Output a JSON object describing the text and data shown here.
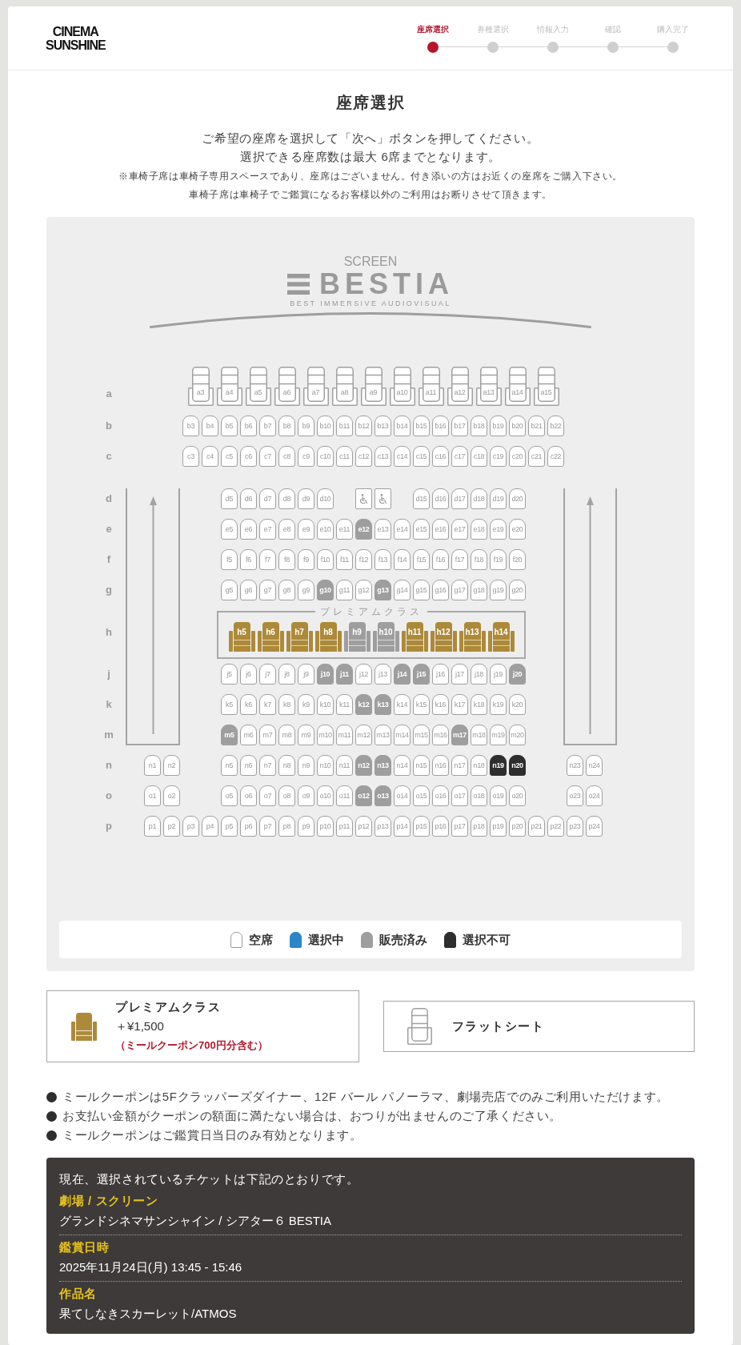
{
  "header": {
    "logo": "CINEMA SUNSHINE",
    "steps": [
      {
        "label": "座席選択",
        "selected": true
      },
      {
        "label": "券種選択",
        "selected": false
      },
      {
        "label": "情報入力",
        "selected": false
      },
      {
        "label": "確認",
        "selected": false
      },
      {
        "label": "購入完了",
        "selected": false
      }
    ]
  },
  "title": "座席選択",
  "instructions": [
    "ご希望の座席を選択して「次へ」ボタンを押してください。",
    "選択できる座席数は最大 6席までとなります。"
  ],
  "notices": [
    "※車椅子席は車椅子専用スペースであり、座席はございません。付き添いの方はお近くの座席をご購入下さい。",
    "車椅子席は車椅子でご鑑賞になるお客様以外のご利用はお断りさせて頂きます。"
  ],
  "seat_map": {
    "screen": {
      "caption": "SCREEN",
      "name": "BESTIA",
      "tagline": "BEST IMMERSIVE AUDIOVISUAL"
    },
    "blocks": [
      {
        "aisles": false,
        "rows": [
          {
            "label": "a",
            "kind": "flat",
            "seats": [
              {
                "kind": "free",
                "label": "a3"
              },
              {
                "kind": "free",
                "label": "a4"
              },
              {
                "kind": "free",
                "label": "a5"
              },
              {
                "kind": "free",
                "label": "a6"
              },
              {
                "kind": "free",
                "label": "a7"
              },
              {
                "kind": "free",
                "label": "a8"
              },
              {
                "kind": "free",
                "label": "a9"
              },
              {
                "kind": "free",
                "label": "a10"
              },
              {
                "kind": "free",
                "label": "a11"
              },
              {
                "kind": "free",
                "label": "a12"
              },
              {
                "kind": "free",
                "label": "a13"
              },
              {
                "kind": "free",
                "label": "a14"
              },
              {
                "kind": "free",
                "label": "a15"
              }
            ]
          },
          {
            "label": "b",
            "kind": "standard",
            "seats": [
              {
                "kind": "free",
                "label": "b3"
              },
              {
                "kind": "free",
                "label": "b4"
              },
              {
                "kind": "free",
                "label": "b5"
              },
              {
                "kind": "free",
                "label": "b6"
              },
              {
                "kind": "free",
                "label": "b7"
              },
              {
                "kind": "free",
                "label": "b8"
              },
              {
                "kind": "free",
                "label": "b9"
              },
              {
                "kind": "free",
                "label": "b10"
              },
              {
                "kind": "free",
                "label": "b11"
              },
              {
                "kind": "free",
                "label": "b12"
              },
              {
                "kind": "free",
                "label": "b13"
              },
              {
                "kind": "free",
                "label": "b14"
              },
              {
                "kind": "free",
                "label": "b15"
              },
              {
                "kind": "free",
                "label": "b16"
              },
              {
                "kind": "free",
                "label": "b17"
              },
              {
                "kind": "free",
                "label": "b18"
              },
              {
                "kind": "free",
                "label": "b19"
              },
              {
                "kind": "free",
                "label": "b20"
              },
              {
                "kind": "free",
                "label": "b21"
              },
              {
                "kind": "free",
                "label": "b22"
              }
            ]
          },
          {
            "label": "c",
            "kind": "standard",
            "seats": [
              {
                "kind": "free",
                "label": "c3"
              },
              {
                "kind": "free",
                "label": "c4"
              },
              {
                "kind": "free",
                "label": "c5"
              },
              {
                "kind": "free",
                "label": "c6"
              },
              {
                "kind": "free",
                "label": "c7"
              },
              {
                "kind": "free",
                "label": "c8"
              },
              {
                "kind": "free",
                "label": "c9"
              },
              {
                "kind": "free",
                "label": "c10"
              },
              {
                "kind": "free",
                "label": "c11"
              },
              {
                "kind": "free",
                "label": "c12"
              },
              {
                "kind": "free",
                "label": "c13"
              },
              {
                "kind": "free",
                "label": "c14"
              },
              {
                "kind": "free",
                "label": "c15"
              },
              {
                "kind": "free",
                "label": "c16"
              },
              {
                "kind": "free",
                "label": "c17"
              },
              {
                "kind": "free",
                "label": "c18"
              },
              {
                "kind": "free",
                "label": "c19"
              },
              {
                "kind": "free",
                "label": "c20"
              },
              {
                "kind": "free",
                "label": "c21"
              },
              {
                "kind": "free",
                "label": "c22"
              }
            ]
          }
        ]
      },
      {
        "aisles": true,
        "rows": [
          {
            "label": "d",
            "kind": "standard",
            "seats": [
              {
                "kind": "free",
                "label": "d5"
              },
              {
                "kind": "free",
                "label": "d6"
              },
              {
                "kind": "free",
                "label": "d7"
              },
              {
                "kind": "free",
                "label": "d8"
              },
              {
                "kind": "free",
                "label": "d9"
              },
              {
                "kind": "free",
                "label": "d10"
              },
              {
                "kind": "gap"
              },
              {
                "kind": "wheelchair"
              },
              {
                "kind": "wheelchair"
              },
              {
                "kind": "gap"
              },
              {
                "kind": "free",
                "label": "d15"
              },
              {
                "kind": "free",
                "label": "d16"
              },
              {
                "kind": "free",
                "label": "d17"
              },
              {
                "kind": "free",
                "label": "d18"
              },
              {
                "kind": "free",
                "label": "d19"
              },
              {
                "kind": "free",
                "label": "d20"
              }
            ]
          },
          {
            "label": "e",
            "kind": "standard",
            "seats": [
              {
                "kind": "free",
                "label": "e5"
              },
              {
                "kind": "free",
                "label": "e6"
              },
              {
                "kind": "free",
                "label": "e7"
              },
              {
                "kind": "free",
                "label": "e8"
              },
              {
                "kind": "free",
                "label": "e9"
              },
              {
                "kind": "free",
                "label": "e10"
              },
              {
                "kind": "free",
                "label": "e11"
              },
              {
                "kind": "sold",
                "label": "e12"
              },
              {
                "kind": "free",
                "label": "e13"
              },
              {
                "kind": "free",
                "label": "e14"
              },
              {
                "kind": "free",
                "label": "e15"
              },
              {
                "kind": "free",
                "label": "e16"
              },
              {
                "kind": "free",
                "label": "e17"
              },
              {
                "kind": "free",
                "label": "e18"
              },
              {
                "kind": "free",
                "label": "e19"
              },
              {
                "kind": "free",
                "label": "e20"
              }
            ]
          },
          {
            "label": "f",
            "kind": "standard",
            "seats": [
              {
                "kind": "free",
                "label": "f5"
              },
              {
                "kind": "free",
                "label": "f6"
              },
              {
                "kind": "free",
                "label": "f7"
              },
              {
                "kind": "free",
                "label": "f8"
              },
              {
                "kind": "free",
                "label": "f9"
              },
              {
                "kind": "free",
                "label": "f10"
              },
              {
                "kind": "free",
                "label": "f11"
              },
              {
                "kind": "free",
                "label": "f12"
              },
              {
                "kind": "free",
                "label": "f13"
              },
              {
                "kind": "free",
                "label": "f14"
              },
              {
                "kind": "free",
                "label": "f15"
              },
              {
                "kind": "free",
                "label": "f16"
              },
              {
                "kind": "free",
                "label": "f17"
              },
              {
                "kind": "free",
                "label": "f18"
              },
              {
                "kind": "free",
                "label": "f19"
              },
              {
                "kind": "free",
                "label": "f20"
              }
            ]
          },
          {
            "label": "g",
            "kind": "standard",
            "seats": [
              {
                "kind": "free",
                "label": "g5"
              },
              {
                "kind": "free",
                "label": "g6"
              },
              {
                "kind": "free",
                "label": "g7"
              },
              {
                "kind": "free",
                "label": "g8"
              },
              {
                "kind": "free",
                "label": "g9"
              },
              {
                "kind": "sold",
                "label": "g10"
              },
              {
                "kind": "free",
                "label": "g11"
              },
              {
                "kind": "free",
                "label": "g12"
              },
              {
                "kind": "sold",
                "label": "g13"
              },
              {
                "kind": "free",
                "label": "g14"
              },
              {
                "kind": "free",
                "label": "g15"
              },
              {
                "kind": "free",
                "label": "g16"
              },
              {
                "kind": "free",
                "label": "g17"
              },
              {
                "kind": "free",
                "label": "g18"
              },
              {
                "kind": "free",
                "label": "g19"
              },
              {
                "kind": "free",
                "label": "g20"
              }
            ]
          },
          {
            "label": "h",
            "kind": "premium",
            "title": "プレミアムクラス",
            "seats": [
              {
                "kind": "free",
                "label": "h5"
              },
              {
                "kind": "free",
                "label": "h6"
              },
              {
                "kind": "free",
                "label": "h7"
              },
              {
                "kind": "free",
                "label": "h8"
              },
              {
                "kind": "sold",
                "label": "h9"
              },
              {
                "kind": "sold",
                "label": "h10"
              },
              {
                "kind": "free",
                "label": "h11"
              },
              {
                "kind": "free",
                "label": "h12"
              },
              {
                "kind": "free",
                "label": "h13"
              },
              {
                "kind": "free",
                "label": "h14"
              }
            ]
          },
          {
            "label": "j",
            "kind": "standard",
            "seats": [
              {
                "kind": "free",
                "label": "j5"
              },
              {
                "kind": "free",
                "label": "j6"
              },
              {
                "kind": "free",
                "label": "j7"
              },
              {
                "kind": "free",
                "label": "j8"
              },
              {
                "kind": "free",
                "label": "j9"
              },
              {
                "kind": "sold",
                "label": "j10"
              },
              {
                "kind": "sold",
                "label": "j11"
              },
              {
                "kind": "free",
                "label": "j12"
              },
              {
                "kind": "free",
                "label": "j13"
              },
              {
                "kind": "sold",
                "label": "j14"
              },
              {
                "kind": "sold",
                "label": "j15"
              },
              {
                "kind": "free",
                "label": "j16"
              },
              {
                "kind": "free",
                "label": "j17"
              },
              {
                "kind": "free",
                "label": "j18"
              },
              {
                "kind": "free",
                "label": "j19"
              },
              {
                "kind": "sold",
                "label": "j20"
              }
            ]
          },
          {
            "label": "k",
            "kind": "standard",
            "seats": [
              {
                "kind": "free",
                "label": "k5"
              },
              {
                "kind": "free",
                "label": "k6"
              },
              {
                "kind": "free",
                "label": "k7"
              },
              {
                "kind": "free",
                "label": "k8"
              },
              {
                "kind": "free",
                "label": "k9"
              },
              {
                "kind": "free",
                "label": "k10"
              },
              {
                "kind": "free",
                "label": "k11"
              },
              {
                "kind": "sold",
                "label": "k12"
              },
              {
                "kind": "sold",
                "label": "k13"
              },
              {
                "kind": "free",
                "label": "k14"
              },
              {
                "kind": "free",
                "label": "k15"
              },
              {
                "kind": "free",
                "label": "k16"
              },
              {
                "kind": "free",
                "label": "k17"
              },
              {
                "kind": "free",
                "label": "k18"
              },
              {
                "kind": "free",
                "label": "k19"
              },
              {
                "kind": "free",
                "label": "k20"
              }
            ]
          },
          {
            "label": "m",
            "kind": "standard",
            "seats": [
              {
                "kind": "sold",
                "label": "m5"
              },
              {
                "kind": "free",
                "label": "m6"
              },
              {
                "kind": "free",
                "label": "m7"
              },
              {
                "kind": "free",
                "label": "m8"
              },
              {
                "kind": "free",
                "label": "m9"
              },
              {
                "kind": "free",
                "label": "m10"
              },
              {
                "kind": "free",
                "label": "m11"
              },
              {
                "kind": "free",
                "label": "m12"
              },
              {
                "kind": "free",
                "label": "m13"
              },
              {
                "kind": "free",
                "label": "m14"
              },
              {
                "kind": "free",
                "label": "m15"
              },
              {
                "kind": "free",
                "label": "m16"
              },
              {
                "kind": "sold",
                "label": "m17"
              },
              {
                "kind": "free",
                "label": "m18"
              },
              {
                "kind": "free",
                "label": "m19"
              },
              {
                "kind": "free",
                "label": "m20"
              }
            ]
          }
        ]
      },
      {
        "aisles": false,
        "rows": [
          {
            "label": "n",
            "kind": "standard",
            "seats": [
              {
                "kind": "free",
                "label": "n1"
              },
              {
                "kind": "free",
                "label": "n2"
              },
              {
                "kind": "gap"
              },
              {
                "kind": "gap"
              },
              {
                "kind": "free",
                "label": "n5"
              },
              {
                "kind": "free",
                "label": "n6"
              },
              {
                "kind": "free",
                "label": "n7"
              },
              {
                "kind": "free",
                "label": "n8"
              },
              {
                "kind": "free",
                "label": "n9"
              },
              {
                "kind": "free",
                "label": "n10"
              },
              {
                "kind": "free",
                "label": "n11"
              },
              {
                "kind": "sold",
                "label": "n12"
              },
              {
                "kind": "sold",
                "label": "n13"
              },
              {
                "kind": "free",
                "label": "n14"
              },
              {
                "kind": "free",
                "label": "n15"
              },
              {
                "kind": "free",
                "label": "n16"
              },
              {
                "kind": "free",
                "label": "n17"
              },
              {
                "kind": "free",
                "label": "n18"
              },
              {
                "kind": "blocked",
                "label": "n19"
              },
              {
                "kind": "blocked",
                "label": "n20"
              },
              {
                "kind": "gap"
              },
              {
                "kind": "gap"
              },
              {
                "kind": "free",
                "label": "n23"
              },
              {
                "kind": "free",
                "label": "n24"
              }
            ]
          },
          {
            "label": "o",
            "kind": "standard",
            "seats": [
              {
                "kind": "free",
                "label": "o1"
              },
              {
                "kind": "free",
                "label": "o2"
              },
              {
                "kind": "gap"
              },
              {
                "kind": "gap"
              },
              {
                "kind": "free",
                "label": "o5"
              },
              {
                "kind": "free",
                "label": "o6"
              },
              {
                "kind": "free",
                "label": "o7"
              },
              {
                "kind": "free",
                "label": "o8"
              },
              {
                "kind": "free",
                "label": "o9"
              },
              {
                "kind": "free",
                "label": "o10"
              },
              {
                "kind": "free",
                "label": "o11"
              },
              {
                "kind": "sold",
                "label": "o12"
              },
              {
                "kind": "sold",
                "label": "o13"
              },
              {
                "kind": "free",
                "label": "o14"
              },
              {
                "kind": "free",
                "label": "o15"
              },
              {
                "kind": "free",
                "label": "o16"
              },
              {
                "kind": "free",
                "label": "o17"
              },
              {
                "kind": "free",
                "label": "o18"
              },
              {
                "kind": "free",
                "label": "o19"
              },
              {
                "kind": "free",
                "label": "o20"
              },
              {
                "kind": "gap"
              },
              {
                "kind": "gap"
              },
              {
                "kind": "free",
                "label": "o23"
              },
              {
                "kind": "free",
                "label": "o24"
              }
            ]
          },
          {
            "label": "p",
            "kind": "standard",
            "seats": [
              {
                "kind": "free",
                "label": "p1"
              },
              {
                "kind": "free",
                "label": "p2"
              },
              {
                "kind": "free",
                "label": "p3"
              },
              {
                "kind": "free",
                "label": "p4"
              },
              {
                "kind": "free",
                "label": "p5"
              },
              {
                "kind": "free",
                "label": "p6"
              },
              {
                "kind": "free",
                "label": "p7"
              },
              {
                "kind": "free",
                "label": "p8"
              },
              {
                "kind": "free",
                "label": "p9"
              },
              {
                "kind": "free",
                "label": "p10"
              },
              {
                "kind": "free",
                "label": "p11"
              },
              {
                "kind": "free",
                "label": "p12"
              },
              {
                "kind": "free",
                "label": "p13"
              },
              {
                "kind": "free",
                "label": "p14"
              },
              {
                "kind": "free",
                "label": "p15"
              },
              {
                "kind": "free",
                "label": "p16"
              },
              {
                "kind": "free",
                "label": "p17"
              },
              {
                "kind": "free",
                "label": "p18"
              },
              {
                "kind": "free",
                "label": "p19"
              },
              {
                "kind": "free",
                "label": "p20"
              },
              {
                "kind": "free",
                "label": "p21"
              },
              {
                "kind": "free",
                "label": "p22"
              },
              {
                "kind": "free",
                "label": "p23"
              },
              {
                "kind": "free",
                "label": "p24"
              }
            ]
          }
        ]
      }
    ],
    "legend": [
      {
        "kind": "free",
        "label": "空席"
      },
      {
        "kind": "selected",
        "label": "選択中"
      },
      {
        "kind": "sold",
        "label": "販売済み"
      },
      {
        "kind": "blocked",
        "label": "選択不可"
      }
    ]
  },
  "seat_types": [
    {
      "kind": "premium",
      "name": "プレミアムクラス",
      "price": "＋¥1,500",
      "note": "（ミールクーポン700円分含む）"
    },
    {
      "kind": "flat",
      "name": "フラットシート"
    }
  ],
  "coupon_notes": [
    "ミールクーポンは5Fクラッパーズダイナー、12F バール パノーラマ、劇場売店でのみご利用いただけます。",
    "お支払い金額がクーポンの額面に満たない場合は、おつりが出ませんのご了承ください。",
    "ミールクーポンはご鑑賞日当日のみ有効となります。"
  ],
  "summary": {
    "intro": "現在、選択されているチケットは下記のとおりです。",
    "items": [
      {
        "label": "劇場 / スクリーン",
        "value": "グランドシネマサンシャイン / シアター６ BESTIA"
      },
      {
        "label": "鑑賞日時",
        "value": "2025年11月24日(月) 13:45 - 15:46"
      },
      {
        "label": "作品名",
        "value": "果てしなきスカーレット/ATMOS"
      }
    ]
  }
}
